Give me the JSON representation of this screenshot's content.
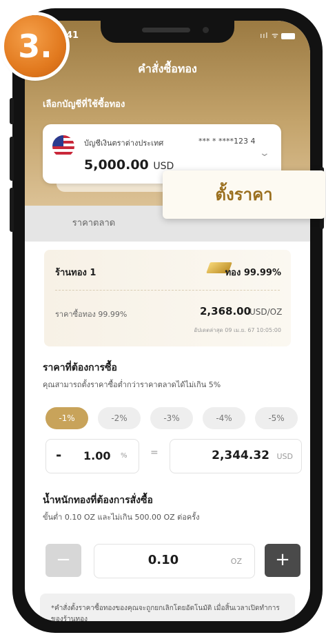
{
  "step_badge": "3.",
  "status_bar": {
    "time": "41",
    "icons": "ııl ᯤ"
  },
  "header": {
    "back_icon": "‹",
    "title": "คำสั่งซื้อทอง"
  },
  "account_section": {
    "label": "เลือกบัญชีที่ใช้ซื้อทอง",
    "account_name": "บัญชีเงินตราต่างประเทศ",
    "account_number": "*** * ****123 4",
    "amount": "5,000.00",
    "currency": "USD",
    "chevron": "⌄"
  },
  "tabs": {
    "market": "ราคาตลาด",
    "set_price": "ตั้งราคา"
  },
  "shop": {
    "name": "ร้านทอง 1",
    "purity": "ทอง 99.99%",
    "price_label": "ราคาซื้อทอง 99.99%",
    "price_value": "2,368.00",
    "price_unit": "USD/OZ",
    "updated": "อัปเดตล่าสุด 09 เม.ย. 67 10:05:00"
  },
  "target_price": {
    "title": "ราคาที่ต้องการซื้อ",
    "note": "คุณสามารถตั้งราคาซื้อต่ำกว่าราคาตลาดได้ไม่เกิน 5%",
    "chips": [
      "-1%",
      "-2%",
      "-3%",
      "-4%",
      "-5%"
    ],
    "active_chip": 0,
    "minus_sign": "-",
    "percent_value": "1.00",
    "percent_unit": "%",
    "equals": "=",
    "value": "2,344.32",
    "unit": "USD"
  },
  "weight": {
    "title": "น้ำหนักทองที่ต้องการสั่งซื้อ",
    "note": "ขั้นต่ำ 0.10 OZ และไม่เกิน 500.00 OZ ต่อครั้ง",
    "minus": "−",
    "value": "0.10",
    "unit": "OZ",
    "plus": "+"
  },
  "disclaimer": "*คำสั่งตั้งราคาซื้อทองของคุณจะถูกยกเลิกโดยอัตโนมัติ เมื่อสิ้นเวลาเปิดทำการของร้านทอง",
  "colors": {
    "gold_accent": "#c8a35a",
    "set_price_text": "#9a6f1e",
    "badge_orange": "#e27a1f"
  }
}
